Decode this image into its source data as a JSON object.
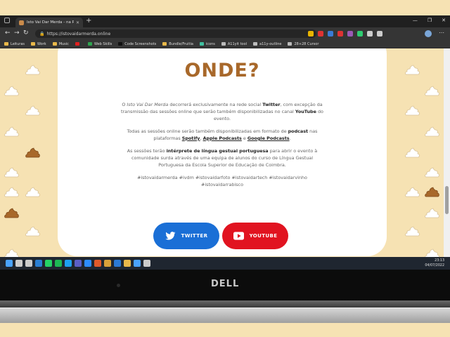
{
  "browser": {
    "tab_title": "Isto Vai Dar Merda - na Pandemia",
    "tab_close": "✕",
    "new_tab": "+",
    "window_controls": [
      "—",
      "❐",
      "✕"
    ],
    "url": "https://istovaidarmerda.online",
    "nav": {
      "back": "←",
      "forward": "→",
      "reload": "↻"
    },
    "more": "⋯",
    "bookmarks": [
      {
        "label": "Leituras",
        "icon_color": "#e8b84a"
      },
      {
        "label": "Work",
        "icon_color": "#e8b84a"
      },
      {
        "label": "Music",
        "icon_color": "#e8b84a"
      },
      {
        "label": "",
        "icon_color": "#e02020"
      },
      {
        "label": "Web Skills",
        "icon_color": "#2ea44f"
      },
      {
        "label": "Code Screenshots",
        "icon_color": "#111111"
      },
      {
        "label": "Bundle/Fruitia",
        "icon_color": "#e8b84a"
      },
      {
        "label": "icons",
        "icon_color": "#40c0a0"
      },
      {
        "label": "A11yit tool",
        "icon_color": "#bbbbbb"
      },
      {
        "label": "a11y-outline",
        "icon_color": "#bbbbbb"
      },
      {
        "label": "28+28 Cursor",
        "icon_color": "#bbbbbb"
      }
    ],
    "extension_colors": [
      "#e8b400",
      "#d33",
      "#3a7bd5",
      "#d33",
      "#9b59b6",
      "#2ecc71",
      "#cccccc",
      "#cccccc"
    ]
  },
  "content": {
    "heading": "ONDE?",
    "paragraphs": {
      "p1": [
        "O ",
        "Isto Vai Dar Merda",
        " decorrerá exclusivamente na rede social ",
        "Twitter",
        ", com excepção da transmissão das sessões online que serão também disponibilizadas no canal ",
        "YouTube",
        " do evento."
      ],
      "p2": [
        "Todas as sessões online serão também disponibilizadas em formato de ",
        "podcast",
        " nas plataformas ",
        "Spotify",
        ", ",
        "Apple Podcasts",
        " e ",
        "Google Podcasts",
        "."
      ],
      "p3": [
        "As sessões terão ",
        "intérprete de língua gestual portuguesa",
        " para abrir o evento à comunidade surda através de uma equipa de alunos do curso de Língua Gestual Portuguesa da Escola Superior de Educação de Coimbra."
      ],
      "p4": "#istovaidarmerda #ivdm #istovaidarfoto #istovaidartech #istovaidarvinho #istovaidarrabisco"
    },
    "buttons": {
      "twitter": "TWITTER",
      "youtube": "YOUTUBE"
    },
    "colors": {
      "heading": "#a8682a",
      "twitter": "#1a6fd6",
      "youtube": "#e11320",
      "background": "#f6e2b3"
    }
  },
  "taskbar": {
    "time": "23:13",
    "date": "04/07/2022",
    "icons": [
      "windows-icon",
      "search-icon",
      "task-view-icon",
      "edge-icon",
      "whatsapp-icon",
      "spotify-icon",
      "twitter-icon",
      "teams-icon",
      "zoom-icon",
      "app-icon",
      "app-icon",
      "vscode-icon",
      "explorer-icon",
      "paint-icon",
      "chrome-icon"
    ]
  },
  "device": {
    "brand": "DELL"
  }
}
